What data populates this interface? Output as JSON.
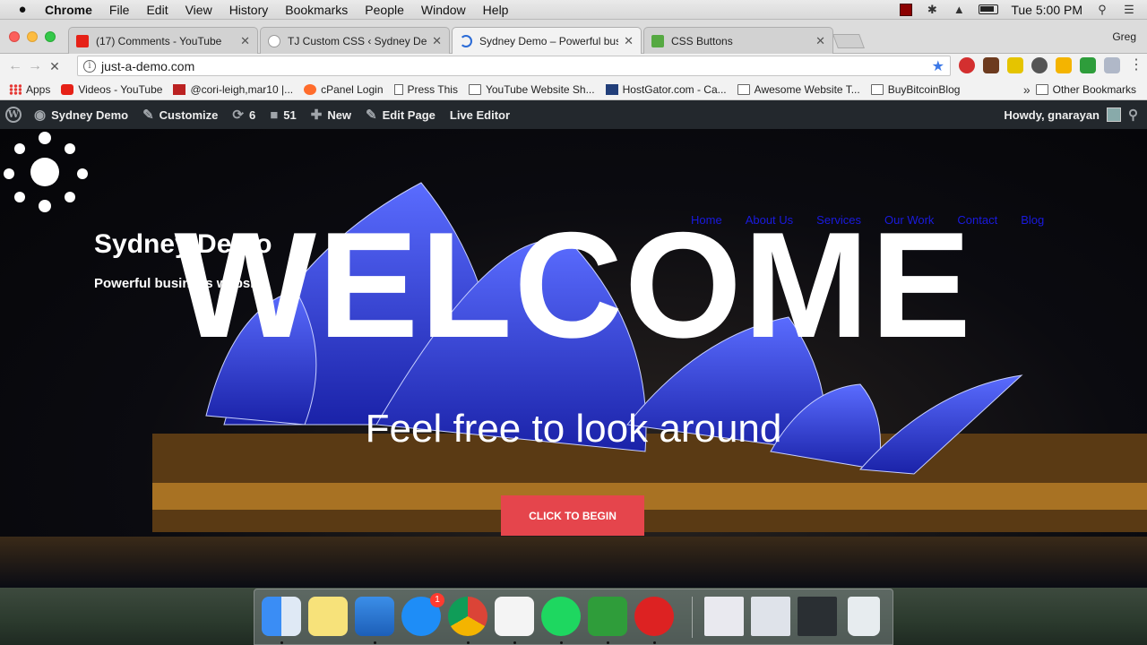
{
  "menubar": {
    "items": [
      "Chrome",
      "File",
      "Edit",
      "View",
      "History",
      "Bookmarks",
      "People",
      "Window",
      "Help"
    ],
    "clock": "Tue 5:00 PM"
  },
  "tabs": [
    {
      "title": "(17) Comments - YouTube",
      "favicon": "youtube-icon"
    },
    {
      "title": "TJ Custom CSS ‹ Sydney Demo",
      "favicon": "wordpress-icon"
    },
    {
      "title": "Sydney Demo – Powerful business",
      "favicon": "loading-icon",
      "active": true
    },
    {
      "title": "CSS Buttons",
      "favicon": "css-icon"
    }
  ],
  "profile_name": "Greg",
  "address": {
    "url": "just-a-demo.com"
  },
  "bookmarks": [
    {
      "label": "Apps",
      "icon": "apps-icon"
    },
    {
      "label": "Videos - YouTube",
      "icon": "youtube-icon"
    },
    {
      "label": "@cori-leigh,mar10 |...",
      "icon": "image-icon"
    },
    {
      "label": "cPanel Login",
      "icon": "cpanel-icon"
    },
    {
      "label": "Press This",
      "icon": "document-icon"
    },
    {
      "label": "YouTube Website Sh...",
      "icon": "folder-icon"
    },
    {
      "label": "HostGator.com - Ca...",
      "icon": "hostgator-icon"
    },
    {
      "label": "Awesome Website T...",
      "icon": "folder-icon"
    },
    {
      "label": "BuyBitcoinBlog",
      "icon": "folder-icon"
    }
  ],
  "other_bookmarks": "Other Bookmarks",
  "wp_admin": {
    "site": "Sydney Demo",
    "customize": "Customize",
    "updates": "6",
    "comments": "51",
    "new": "New",
    "edit_page": "Edit Page",
    "live_editor": "Live Editor",
    "howdy": "Howdy, gnarayan"
  },
  "site": {
    "title": "Sydney Demo",
    "tagline": "Powerful business website",
    "nav": [
      "Home",
      "About Us",
      "Services",
      "Our Work",
      "Contact",
      "Blog"
    ],
    "headline": "WELCOME",
    "subtitle": "Feel free to look around",
    "cta": "CLICK TO BEGIN"
  },
  "dock": {
    "apps": [
      "finder-icon",
      "notes-icon",
      "keynote-icon",
      "app-store-icon",
      "chrome-icon",
      "textedit-icon",
      "spotify-icon",
      "camtasia-icon",
      "bol-icon"
    ],
    "app_store_badge": "1"
  },
  "colors": {
    "cta": "#e5454c",
    "nav_link": "#1a1adf",
    "wp_bar": "#23282d"
  }
}
